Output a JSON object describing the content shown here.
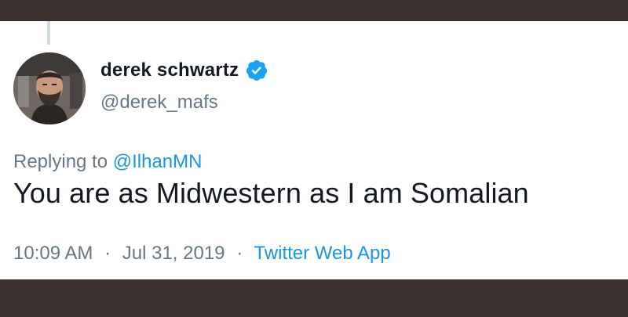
{
  "tweet": {
    "display_name": "derek schwartz",
    "verified": true,
    "handle": "@derek_mafs",
    "replying_prefix": "Replying to",
    "replying_to": "@IlhanMN",
    "text": "You are as Midwestern as I am Somalian",
    "time": "10:09 AM",
    "separator": "·",
    "date": "Jul 31, 2019",
    "source": "Twitter Web App"
  },
  "colors": {
    "background_frame": "#3b302e",
    "card": "#ffffff",
    "text_primary": "#141823",
    "text_secondary": "#657786",
    "link": "#1b95e0",
    "verified_badge": "#1da1f2"
  },
  "icons": {
    "verified": "verified-badge-icon",
    "avatar": "profile-photo"
  }
}
